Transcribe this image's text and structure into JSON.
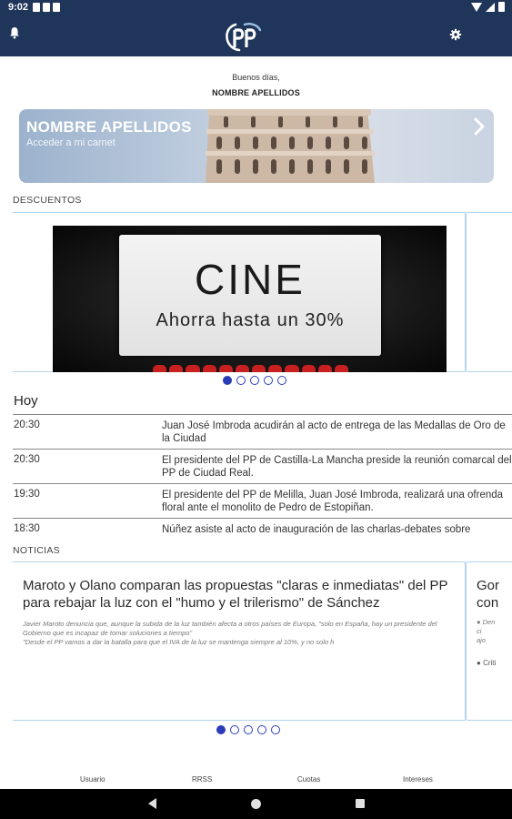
{
  "status_bar": {
    "time": "9:02"
  },
  "greeting": {
    "text": "Buenos días,",
    "name": "NOMBRE APELLIDOS"
  },
  "card": {
    "name": "NOMBRE APELLIDOS",
    "subtitle": "Acceder a mi carnet"
  },
  "discounts": {
    "label": "DESCUENTOS",
    "slide_title": "CINE",
    "slide_subtitle": "Ahorra hasta un 30%",
    "dot_count": 5,
    "active_dot": 1
  },
  "today": {
    "title": "Hoy",
    "events": [
      {
        "time": "20:30",
        "text": "Juan José Imbroda acudirán al acto de entrega de las Medallas de Oro de la Ciudad"
      },
      {
        "time": "20:30",
        "text": "El presidente del PP de Castilla-La Mancha preside la reunión comarcal del PP de Ciudad Real."
      },
      {
        "time": "19:30",
        "text": "El presidente del PP de Melilla, Juan José Imbroda, realizará una ofrenda floral ante el monolito de Pedro de Estopiñan."
      },
      {
        "time": "18:30",
        "text": "Núñez asiste al acto de inauguración de las charlas-debates sobre"
      }
    ]
  },
  "news": {
    "label": "NOTICIAS",
    "main": {
      "title": "Maroto y Olano comparan las propuestas \"claras e inmediatas\" del PP para rebajar la luz con el \"humo y el trilerismo\" de Sánchez",
      "summary_1": "Javier Maroto denuncia que, aunque la subida de la luz también afecta a otros países de Europa, \"solo en España, hay un presidente del Gobierno que es incapaz de tomar soluciones a tiempo\"",
      "summary_2": "\"Desde el PP vamos a dar la batalla para que el IVA de la luz se mantenga siempre al 10%, y no solo h"
    },
    "next": {
      "title_1": "Gor",
      "title_2": "con",
      "bullet_1": "Den",
      "bullet_2": "ci",
      "bullet_3": "ajo",
      "bullet_4": "Criti"
    },
    "dot_count": 5,
    "active_dot": 1
  },
  "bottom_nav": {
    "items": [
      "Usuario",
      "RRSS",
      "Cuotas",
      "Intereses"
    ]
  },
  "colors": {
    "header": "#1f3559",
    "accent": "#2a3db7",
    "border": "#b3d4ee",
    "seat": "#c82020"
  },
  "icons": {
    "bell": "bell-icon",
    "logo": "pp-logo",
    "settings": "gear-icon",
    "chevron": "chevron-right-icon"
  }
}
